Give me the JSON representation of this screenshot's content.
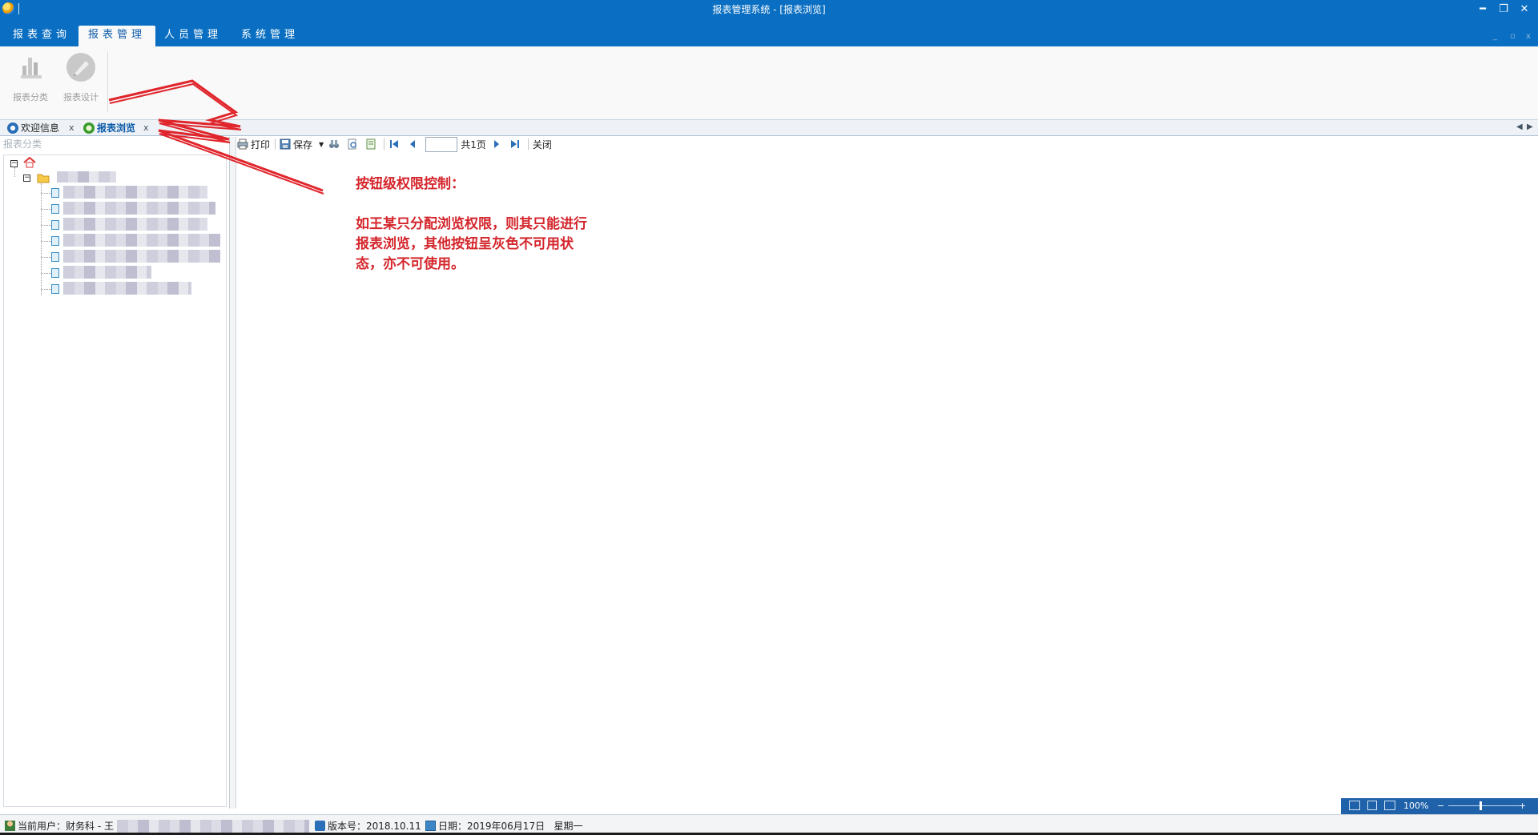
{
  "window": {
    "title": "报表管理系统 - [报表浏览]",
    "minimize": "━",
    "restore": "❐",
    "close": "✕"
  },
  "menu": {
    "tabs": [
      {
        "label": "报表查询"
      },
      {
        "label": "报表管理",
        "active": true
      },
      {
        "label": "人员管理"
      },
      {
        "label": "系统管理"
      }
    ],
    "mini_controls": [
      "_",
      "▫",
      "x"
    ]
  },
  "ribbon": {
    "buttons": [
      {
        "label": "报表分类",
        "icon": "chart-bars-icon",
        "enabled": false
      },
      {
        "label": "报表设计",
        "icon": "design-pen-icon",
        "enabled": false
      }
    ]
  },
  "doc_tabs": [
    {
      "label": "欢迎信息",
      "icon": "welcome-icon",
      "close": "x"
    },
    {
      "label": "报表浏览",
      "icon": "browse-icon",
      "close": "x",
      "active": true
    }
  ],
  "tab_nav": {
    "prev": "◀",
    "next": "▶"
  },
  "tree_panel": {
    "header": "报表分类"
  },
  "report_toolbar": {
    "print": "打印",
    "save": "保存",
    "total_pages": "共1页",
    "close": "关闭",
    "page_value": ""
  },
  "annotation": {
    "title": "按钮级权限控制：",
    "lines": [
      "如王某只分配浏览权限，则其只能进行",
      "报表浏览，其他按钮呈灰色不可用状",
      "态，亦不可使用。"
    ]
  },
  "zoom": {
    "level": "100%",
    "minus": "−",
    "plus": "+"
  },
  "status": {
    "user": "当前用户：财务科 - 王",
    "version": "版本号：2018.10.11",
    "date": "日期：2019年06月17日   星期一"
  },
  "colors": {
    "accent": "#0a6fc2",
    "annotation_red": "#d4262c"
  }
}
